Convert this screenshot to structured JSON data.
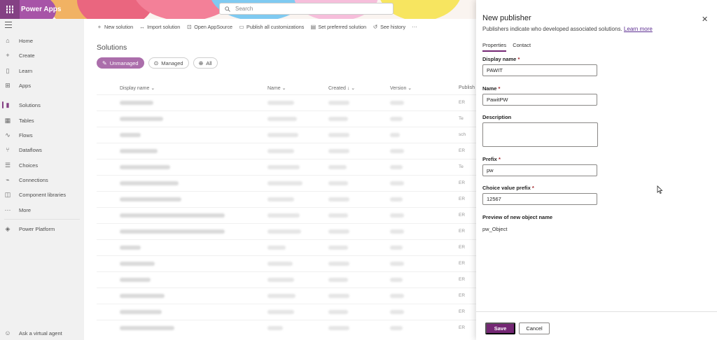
{
  "header": {
    "app_name": "Power Apps",
    "search_placeholder": "Search",
    "brand_color": "#742774"
  },
  "sidebar": {
    "items": [
      {
        "label": "Home",
        "icon": "home-icon"
      },
      {
        "label": "Create",
        "icon": "plus-icon"
      },
      {
        "label": "Learn",
        "icon": "book-icon"
      },
      {
        "label": "Apps",
        "icon": "apps-grid-icon"
      },
      {
        "label": "Solutions",
        "icon": "solutions-icon",
        "active": true
      },
      {
        "label": "Tables",
        "icon": "table-icon"
      },
      {
        "label": "Flows",
        "icon": "flow-icon"
      },
      {
        "label": "Dataflows",
        "icon": "dataflow-icon"
      },
      {
        "label": "Choices",
        "icon": "list-icon"
      },
      {
        "label": "Connections",
        "icon": "plug-icon"
      },
      {
        "label": "Component libraries",
        "icon": "library-icon"
      },
      {
        "label": "More",
        "icon": "ellipsis-icon"
      },
      {
        "label": "Power Platform",
        "icon": "power-platform-icon"
      }
    ],
    "bottom_item": {
      "label": "Ask a virtual agent",
      "icon": "bot-icon"
    }
  },
  "commandbar": {
    "items": [
      {
        "label": "New solution",
        "icon": "plus-icon"
      },
      {
        "label": "Import solution",
        "icon": "import-icon"
      },
      {
        "label": "Open AppSource",
        "icon": "store-icon"
      },
      {
        "label": "Publish all customizations",
        "icon": "publish-icon"
      },
      {
        "label": "Set preferred solution",
        "icon": "preferred-icon"
      },
      {
        "label": "See history",
        "icon": "history-icon"
      }
    ]
  },
  "solutions": {
    "title": "Solutions",
    "filters": [
      {
        "label": "Unmanaged",
        "active": true
      },
      {
        "label": "Managed",
        "active": false
      },
      {
        "label": "All",
        "active": false
      }
    ],
    "columns": [
      "Display name",
      "Name",
      "Created",
      "Version",
      "Publish"
    ],
    "row_suffixes": [
      "ER",
      "Te",
      "sch",
      "ER",
      "Te",
      "ER",
      "ER",
      "ER",
      "ER",
      "ER",
      "ER",
      "ER",
      "ER",
      "ER",
      "ER"
    ]
  },
  "panel": {
    "title": "New publisher",
    "subtitle": "Publishers indicate who developed associated solutions.",
    "learn_more": "Learn more",
    "tabs": [
      {
        "label": "Properties",
        "active": true
      },
      {
        "label": "Contact",
        "active": false
      }
    ],
    "fields": {
      "display_name": {
        "label": "Display name",
        "required_mark": "*",
        "value": "PAWIT"
      },
      "name": {
        "label": "Name",
        "required_mark": "*",
        "value": "PawitPW"
      },
      "description": {
        "label": "Description",
        "value": ""
      },
      "prefix": {
        "label": "Prefix",
        "required_mark": "*",
        "value": "pw"
      },
      "choice_value_prefix": {
        "label": "Choice value prefix",
        "required_mark": "*",
        "value": "12567"
      }
    },
    "preview_label": "Preview of new object name",
    "preview_value": "pw_Object",
    "save_label": "Save",
    "cancel_label": "Cancel"
  }
}
